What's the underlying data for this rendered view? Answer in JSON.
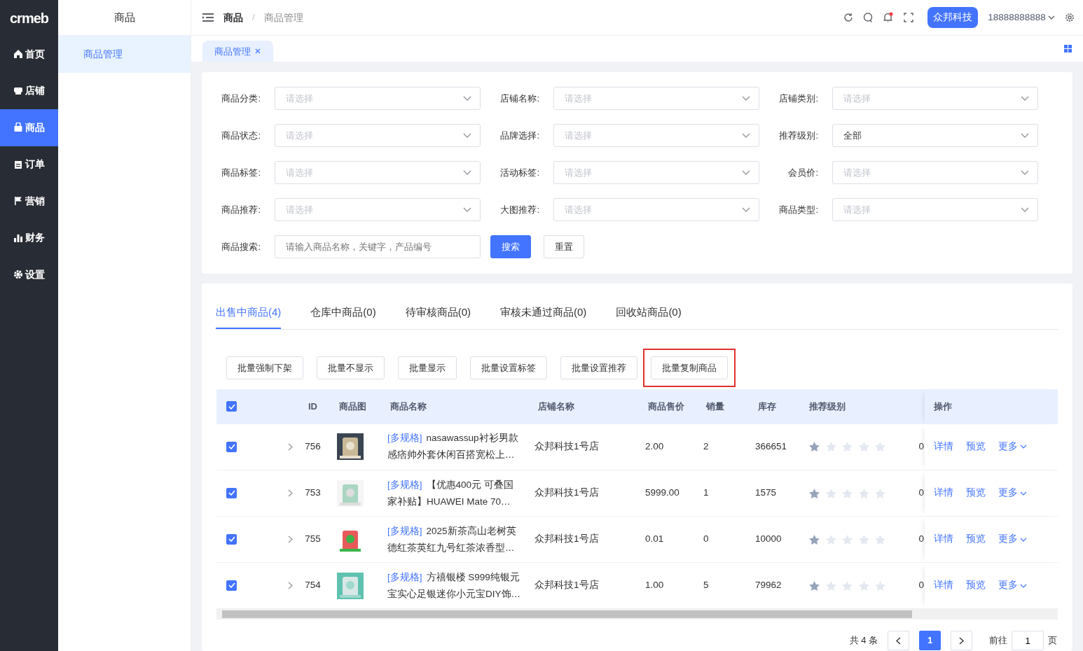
{
  "logo": "crmeb",
  "sidebar": {
    "items": [
      {
        "label": "首页",
        "selected": false
      },
      {
        "label": "店铺",
        "selected": false
      },
      {
        "label": "商品",
        "selected": true
      },
      {
        "label": "订单",
        "selected": false
      },
      {
        "label": "营销",
        "selected": false
      },
      {
        "label": "财务",
        "selected": false
      },
      {
        "label": "设置",
        "selected": false
      }
    ]
  },
  "subnav": {
    "title": "商品",
    "items": [
      {
        "label": "商品管理",
        "selected": true
      }
    ]
  },
  "breadcrumb": [
    "商品",
    "商品管理"
  ],
  "breadcrumb_separator": "/",
  "header": {
    "company": "众邦科技",
    "user": "18888888888",
    "notification_dot": true
  },
  "page_tabs": [
    {
      "label": "商品管理",
      "selected": true
    }
  ],
  "filters": [
    {
      "label": "商品分类:",
      "placeholder": "请选择"
    },
    {
      "label": "店铺名称:",
      "placeholder": "请选择"
    },
    {
      "label": "店铺类别:",
      "placeholder": "请选择"
    },
    {
      "label": "商品状态:",
      "placeholder": "请选择"
    },
    {
      "label": "品牌选择:",
      "placeholder": "请选择"
    },
    {
      "label": "推荐级别:",
      "value": "全部"
    },
    {
      "label": "商品标签:",
      "placeholder": "请选择"
    },
    {
      "label": "活动标签:",
      "placeholder": "请选择"
    },
    {
      "label": "会员价:",
      "placeholder": "请选择"
    },
    {
      "label": "商品推荐:",
      "placeholder": "请选择"
    },
    {
      "label": "大图推荐:",
      "placeholder": "请选择"
    },
    {
      "label": "商品类型:",
      "placeholder": "请选择"
    }
  ],
  "search": {
    "label": "商品搜索:",
    "placeholder": "请输入商品名称，关键字，产品编号",
    "search_button": "搜索",
    "reset_button": "重置"
  },
  "status_tabs": [
    {
      "label": "出售中商品(4)",
      "selected": true
    },
    {
      "label": "仓库中商品(0)",
      "selected": false
    },
    {
      "label": "待审核商品(0)",
      "selected": false
    },
    {
      "label": "审核未通过商品(0)",
      "selected": false
    },
    {
      "label": "回收站商品(0)",
      "selected": false
    }
  ],
  "batch_buttons": [
    {
      "label": "批量强制下架",
      "highlighted": false
    },
    {
      "label": "批量不显示",
      "highlighted": false
    },
    {
      "label": "批量显示",
      "highlighted": false
    },
    {
      "label": "批量设置标签",
      "highlighted": false
    },
    {
      "label": "批量设置推荐",
      "highlighted": false
    },
    {
      "label": "批量复制商品",
      "highlighted": true
    }
  ],
  "table": {
    "all_checked": true,
    "columns": [
      "ID",
      "商品图",
      "商品名称",
      "店铺名称",
      "商品售价",
      "销量",
      "库存",
      "推荐级别",
      "操作"
    ],
    "rows": [
      {
        "checked": true,
        "id": "756",
        "tag": "[多规格]",
        "name": "nasawassup衬衫男款",
        "name_line2": "感痞帅外套休闲百搭宽松上…",
        "shop": "众邦科技1号店",
        "price": "2.00",
        "sales": "2",
        "stock": "366651",
        "stars": 1,
        "column_9": "0",
        "actions": [
          "详情",
          "预览",
          "更多"
        ]
      },
      {
        "checked": true,
        "id": "753",
        "tag": "[多规格]",
        "name": "【优惠400元 可叠国",
        "name_line2": "家补贴】HUAWEI Mate 70…",
        "shop": "众邦科技1号店",
        "price": "5999.00",
        "sales": "1",
        "stock": "1575",
        "stars": 1,
        "column_9": "0",
        "actions": [
          "详情",
          "预览",
          "更多"
        ]
      },
      {
        "checked": true,
        "id": "755",
        "tag": "[多规格]",
        "name": "2025新茶高山老树英",
        "name_line2": "德红茶英红九号红茶浓香型…",
        "shop": "众邦科技1号店",
        "price": "0.01",
        "sales": "0",
        "stock": "10000",
        "stars": 1,
        "column_9": "0",
        "actions": [
          "详情",
          "预览",
          "更多"
        ]
      },
      {
        "checked": true,
        "id": "754",
        "tag": "[多规格]",
        "name": "方禧银楼 S999纯银元",
        "name_line2": "宝实心足银迷你小元宝DIY饰…",
        "shop": "众邦科技1号店",
        "price": "1.00",
        "sales": "5",
        "stock": "79962",
        "stars": 1,
        "column_9": "0",
        "actions": [
          "详情",
          "预览",
          "更多"
        ]
      }
    ]
  },
  "pagination": {
    "total": "共 4 条",
    "pages": [
      {
        "label": "1",
        "selected": true
      }
    ],
    "goto_label": "前往",
    "goto_value": "1",
    "page_suffix": "页"
  }
}
